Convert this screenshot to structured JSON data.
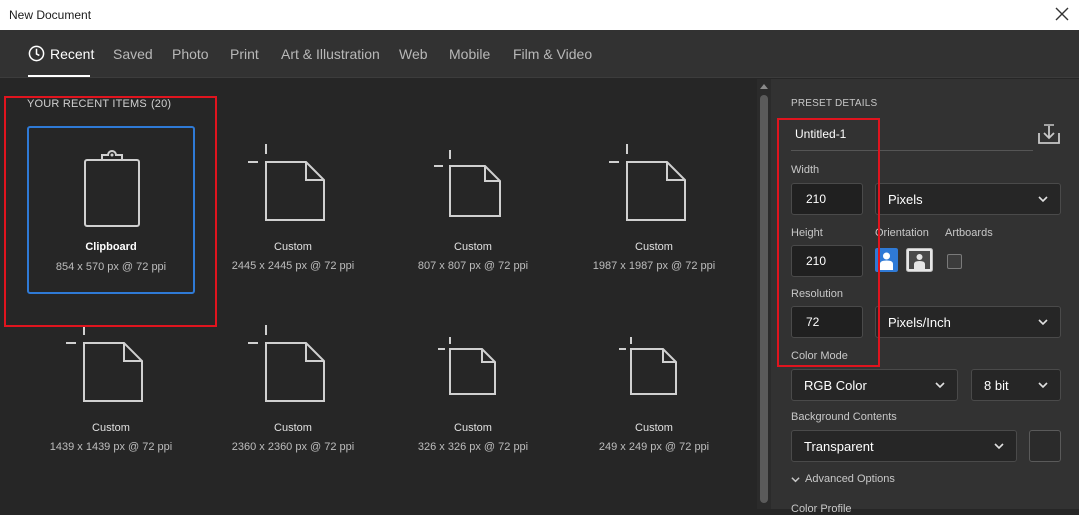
{
  "window": {
    "title": "New Document"
  },
  "tabs": [
    {
      "label": "Recent",
      "active": true
    },
    {
      "label": "Saved"
    },
    {
      "label": "Photo"
    },
    {
      "label": "Print"
    },
    {
      "label": "Art & Illustration"
    },
    {
      "label": "Web"
    },
    {
      "label": "Mobile"
    },
    {
      "label": "Film & Video"
    }
  ],
  "recent": {
    "title": "YOUR RECENT ITEMS",
    "count": "(20)",
    "items": [
      {
        "name": "Clipboard",
        "size": "854 x 570 px @ 72 ppi",
        "icon": "clipboard-icon",
        "selected": true
      },
      {
        "name": "Custom",
        "size": "2445 x 2445 px @ 72 ppi",
        "icon": "document-icon"
      },
      {
        "name": "Custom",
        "size": "807 x 807 px @ 72 ppi",
        "icon": "document-icon"
      },
      {
        "name": "Custom",
        "size": "1987 x 1987 px @ 72 ppi",
        "icon": "document-icon"
      },
      {
        "name": "Custom",
        "size": "1439 x 1439 px @ 72 ppi",
        "icon": "document-icon"
      },
      {
        "name": "Custom",
        "size": "2360 x 2360 px @ 72 ppi",
        "icon": "document-icon"
      },
      {
        "name": "Custom",
        "size": "326 x 326 px @ 72 ppi",
        "icon": "document-icon"
      },
      {
        "name": "Custom",
        "size": "249 x 249 px @ 72 ppi",
        "icon": "document-icon"
      }
    ]
  },
  "preset": {
    "title": "PRESET DETAILS",
    "doc_name": "Untitled-1",
    "width_label": "Width",
    "width_value": "210",
    "width_unit": "Pixels",
    "height_label": "Height",
    "height_value": "210",
    "orientation_label": "Orientation",
    "artboards_label": "Artboards",
    "resolution_label": "Resolution",
    "resolution_value": "72",
    "resolution_unit": "Pixels/Inch",
    "color_mode_label": "Color Mode",
    "color_mode": "RGB Color",
    "bit_depth": "8 bit",
    "background_label": "Background Contents",
    "background": "Transparent",
    "advanced_label": "Advanced Options",
    "color_profile_label": "Color Profile"
  },
  "colors": {
    "accent": "#2f7ad6",
    "highlight": "#e0141e",
    "panel": "#323232"
  }
}
